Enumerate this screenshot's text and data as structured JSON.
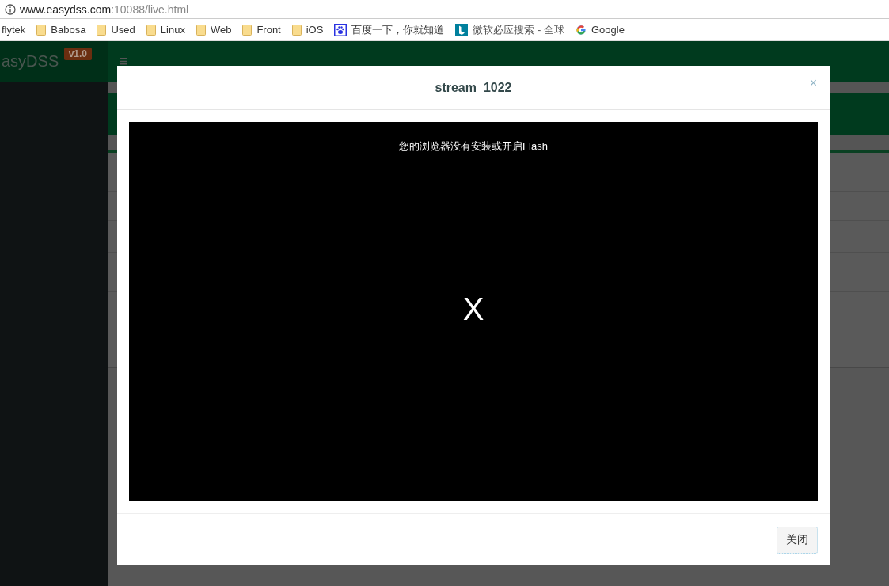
{
  "browser": {
    "url_host": "www.easydss.com",
    "url_rest": ":10088/live.html",
    "bookmarks": [
      {
        "kind": "plain",
        "label": "flytek"
      },
      {
        "kind": "folder",
        "label": "Babosa"
      },
      {
        "kind": "folder",
        "label": "Used"
      },
      {
        "kind": "folder",
        "label": "Linux"
      },
      {
        "kind": "folder",
        "label": "Web"
      },
      {
        "kind": "folder",
        "label": "Front"
      },
      {
        "kind": "folder",
        "label": "iOS"
      },
      {
        "kind": "paw",
        "label": "百度一下，你就知道"
      },
      {
        "kind": "bing",
        "label": "微软必应搜索 - 全球"
      },
      {
        "kind": "google",
        "label": "Google"
      }
    ]
  },
  "app": {
    "logo": "asyDSS",
    "version": "v1.0",
    "menu_glyph": "≡"
  },
  "modal": {
    "title": "stream_1022",
    "close": "×",
    "player": {
      "message": "您的浏览器没有安装或开启Flash",
      "mark": "X"
    },
    "buttons": [
      "关闭"
    ]
  }
}
